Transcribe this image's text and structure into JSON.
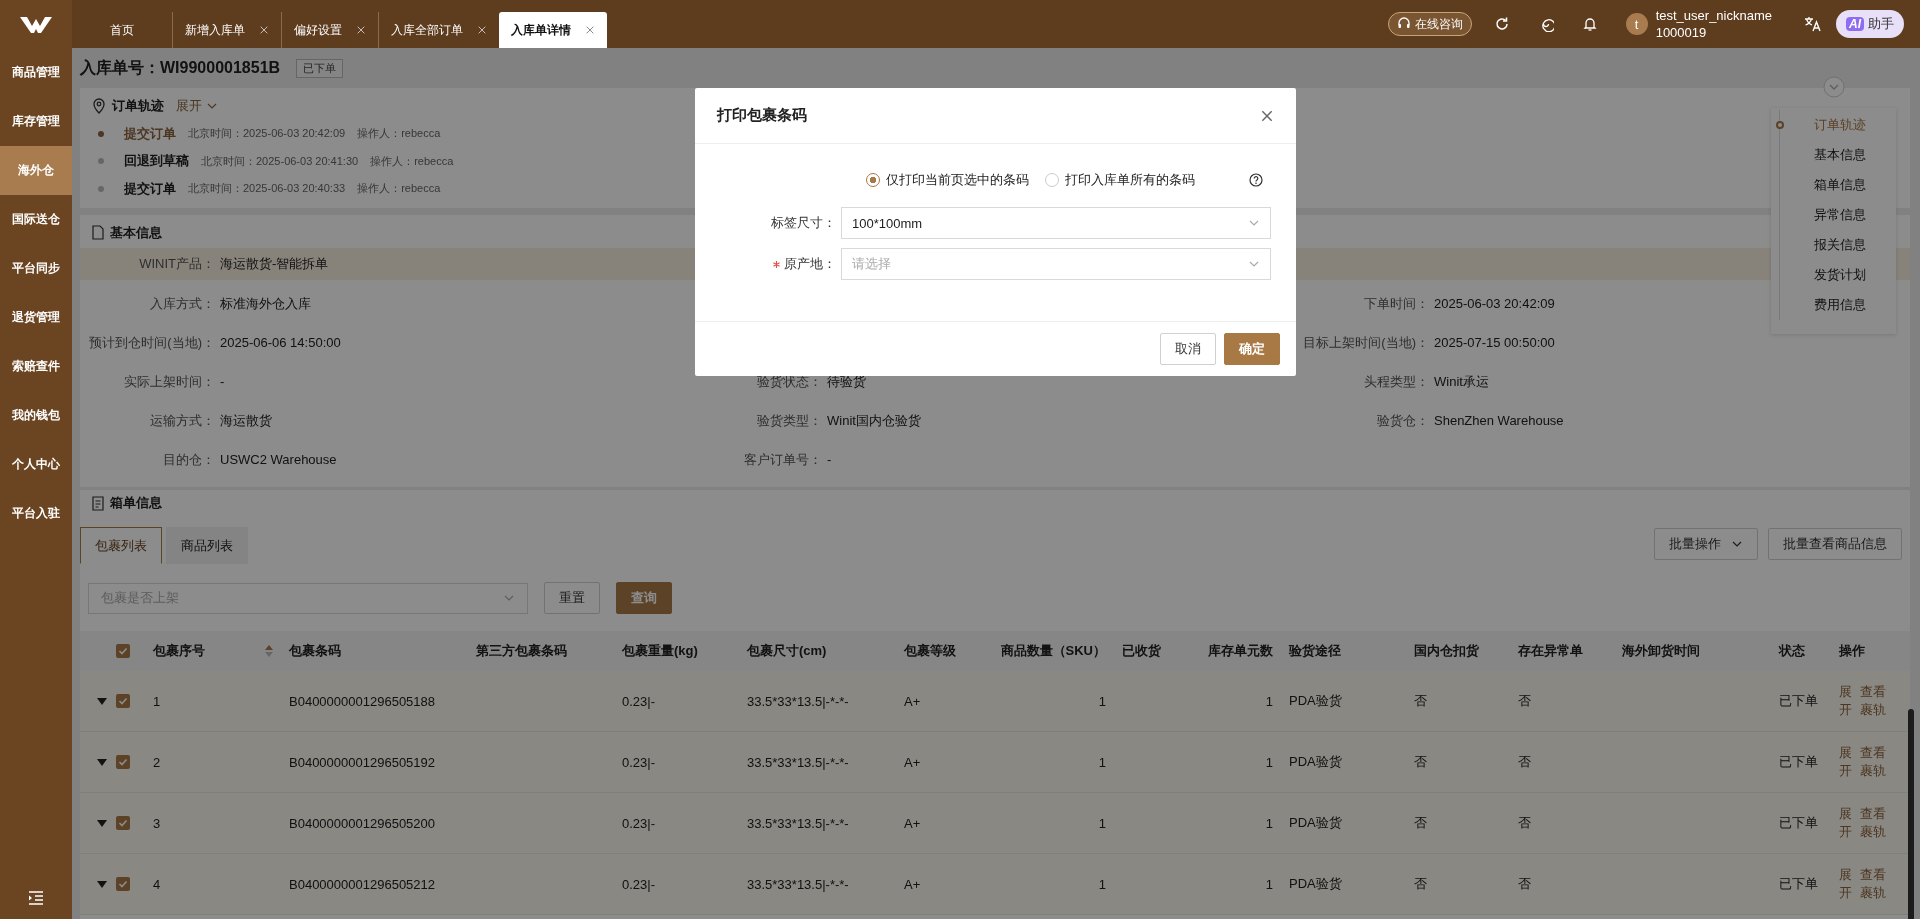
{
  "sidebar": {
    "items": [
      {
        "label": "商品管理",
        "selected": false
      },
      {
        "label": "库存管理",
        "selected": false
      },
      {
        "label": "海外仓",
        "selected": true
      },
      {
        "label": "国际送仓",
        "selected": false
      },
      {
        "label": "平台同步",
        "selected": false
      },
      {
        "label": "退货管理",
        "selected": false
      },
      {
        "label": "索赔查件",
        "selected": false
      },
      {
        "label": "我的钱包",
        "selected": false
      },
      {
        "label": "个人中心",
        "selected": false
      },
      {
        "label": "平台入驻",
        "selected": false
      }
    ]
  },
  "tabs": [
    {
      "label": "首页",
      "closable": false,
      "selected": false
    },
    {
      "label": "新增入库单",
      "closable": true,
      "selected": false
    },
    {
      "label": "偏好设置",
      "closable": true,
      "selected": false
    },
    {
      "label": "入库全部订单",
      "closable": true,
      "selected": false
    },
    {
      "label": "入库单详情",
      "closable": true,
      "selected": true
    }
  ],
  "header": {
    "consult": "在线咨询",
    "user": {
      "avatar": "t",
      "name": "test_user_nickname",
      "id": "1000019"
    },
    "assistant": {
      "badge": "AI",
      "label": "助手"
    }
  },
  "page": {
    "title_label": "入库单号：",
    "order_no": "WI9900001851B",
    "status_tag": "已下单"
  },
  "track": {
    "title": "订单轨迹",
    "toggle": "展开",
    "events": [
      {
        "action": "提交订单",
        "time": "北京时间：2025-06-03 20:42:09",
        "operator": "操作人：rebecca",
        "active": true
      },
      {
        "action": "回退到草稿",
        "time": "北京时间：2025-06-03 20:41:30",
        "operator": "操作人：rebecca",
        "active": false
      },
      {
        "action": "提交订单",
        "time": "北京时间：2025-06-03 20:40:33",
        "operator": "操作人：rebecca",
        "active": false
      }
    ]
  },
  "basic_info": {
    "title": "基本信息",
    "rows": [
      {
        "highlighted": true,
        "left": {
          "label": "WINIT产品：",
          "value": "海运散货-智能拆单"
        }
      },
      {
        "highlighted": false,
        "left": {
          "label": "入库方式：",
          "value": "标准海外仓入库"
        },
        "right": {
          "label": "下单时间：",
          "value": "2025-06-03 20:42:09"
        }
      },
      {
        "highlighted": false,
        "left": {
          "label": "预计到仓时间(当地)：",
          "value": "2025-06-06 14:50:00"
        },
        "right": {
          "label": "目标上架时间(当地)：",
          "value": "2025-07-15 00:50:00"
        }
      },
      {
        "highlighted": false,
        "left": {
          "label": "实际上架时间：",
          "value": "-"
        },
        "middle": {
          "label": "验货状态：",
          "value": "待验货"
        },
        "right": {
          "label": "头程类型：",
          "value": "Winit承运"
        }
      },
      {
        "highlighted": false,
        "left": {
          "label": "运输方式：",
          "value": "海运散货"
        },
        "middle": {
          "label": "验货类型：",
          "value": "Winit国内仓验货"
        },
        "right": {
          "label": "验货仓：",
          "value": "ShenZhen Warehouse"
        }
      },
      {
        "highlighted": false,
        "left": {
          "label": "目的仓：",
          "value": "USWC2 Warehouse"
        },
        "middle": {
          "label": "客户订单号：",
          "value": "-"
        }
      }
    ]
  },
  "anchors": [
    {
      "label": "订单轨迹",
      "selected": true
    },
    {
      "label": "基本信息",
      "selected": false
    },
    {
      "label": "箱单信息",
      "selected": false
    },
    {
      "label": "异常信息",
      "selected": false
    },
    {
      "label": "报关信息",
      "selected": false
    },
    {
      "label": "发货计划",
      "selected": false
    },
    {
      "label": "费用信息",
      "selected": false
    }
  ],
  "packing": {
    "title": "箱单信息",
    "tabs": [
      {
        "label": "包裹列表",
        "selected": true
      },
      {
        "label": "商品列表",
        "selected": false
      }
    ],
    "actions": [
      {
        "label": "批量操作",
        "dropdown": true
      },
      {
        "label": "批量查看商品信息",
        "dropdown": false
      }
    ],
    "filter": {
      "placeholder": "包裹是否上架"
    },
    "buttons": [
      {
        "label": "重置",
        "primary": false
      },
      {
        "label": "查询",
        "primary": true
      }
    ],
    "table": {
      "all_checked": true,
      "columns": [
        {
          "label": "包裹序号",
          "sortable": true
        },
        {
          "label": "包裹条码",
          "sortable": false
        },
        {
          "label": "第三方包裹条码",
          "sortable": false
        },
        {
          "label": "包裹重量(kg)",
          "sortable": false
        },
        {
          "label": "包裹尺寸(cm)",
          "sortable": false
        },
        {
          "label": "包裹等级",
          "sortable": false
        },
        {
          "label": "商品数量（SKU）",
          "sortable": false
        },
        {
          "label": "已收货",
          "sortable": false
        },
        {
          "label": "库存单元数",
          "sortable": false
        },
        {
          "label": "验货途径",
          "sortable": false
        },
        {
          "label": "国内仓扣货",
          "sortable": false
        },
        {
          "label": "存在异常单",
          "sortable": false
        },
        {
          "label": "海外卸货时间",
          "sortable": false
        },
        {
          "label": "状态",
          "sortable": false
        },
        {
          "label": "操作",
          "sortable": false
        }
      ],
      "rows": [
        {
          "checked": true,
          "seq": "1",
          "barcode": "B0400000001296505188",
          "weight": "0.23|-",
          "size": "33.5*33*13.5|-*-*-",
          "grade": "A+",
          "sku_qty": "1",
          "units": "1",
          "inspection": "PDA验货",
          "hold": "否",
          "abnormal": "否",
          "status": "已下单",
          "ops": [
            {
              "label": "展开"
            },
            {
              "label": "查看裹轨"
            }
          ]
        },
        {
          "checked": true,
          "seq": "2",
          "barcode": "B0400000001296505192",
          "weight": "0.23|-",
          "size": "33.5*33*13.5|-*-*-",
          "grade": "A+",
          "sku_qty": "1",
          "units": "1",
          "inspection": "PDA验货",
          "hold": "否",
          "abnormal": "否",
          "status": "已下单",
          "ops": [
            {
              "label": "展开"
            },
            {
              "label": "查看裹轨"
            }
          ]
        },
        {
          "checked": true,
          "seq": "3",
          "barcode": "B0400000001296505200",
          "weight": "0.23|-",
          "size": "33.5*33*13.5|-*-*-",
          "grade": "A+",
          "sku_qty": "1",
          "units": "1",
          "inspection": "PDA验货",
          "hold": "否",
          "abnormal": "否",
          "status": "已下单",
          "ops": [
            {
              "label": "展开"
            },
            {
              "label": "查看裹轨"
            }
          ]
        },
        {
          "checked": true,
          "seq": "4",
          "barcode": "B0400000001296505212",
          "weight": "0.23|-",
          "size": "33.5*33*13.5|-*-*-",
          "grade": "A+",
          "sku_qty": "1",
          "units": "1",
          "inspection": "PDA验货",
          "hold": "否",
          "abnormal": "否",
          "status": "已下单",
          "ops": [
            {
              "label": "展开"
            },
            {
              "label": "查看裹轨"
            }
          ]
        }
      ]
    }
  },
  "dialog": {
    "title": "打印包裹条码",
    "options": [
      {
        "label": "仅打印当前页选中的条码",
        "selected": true
      },
      {
        "label": "打印入库单所有的条码",
        "selected": false
      }
    ],
    "fields": [
      {
        "label": "标签尺寸：",
        "value": "100*100mm",
        "required": false
      },
      {
        "label": "原产地：",
        "placeholder": "请选择",
        "required": true
      }
    ],
    "buttons": [
      {
        "label": "取消",
        "primary": false
      },
      {
        "label": "确定",
        "primary": true
      }
    ]
  }
}
